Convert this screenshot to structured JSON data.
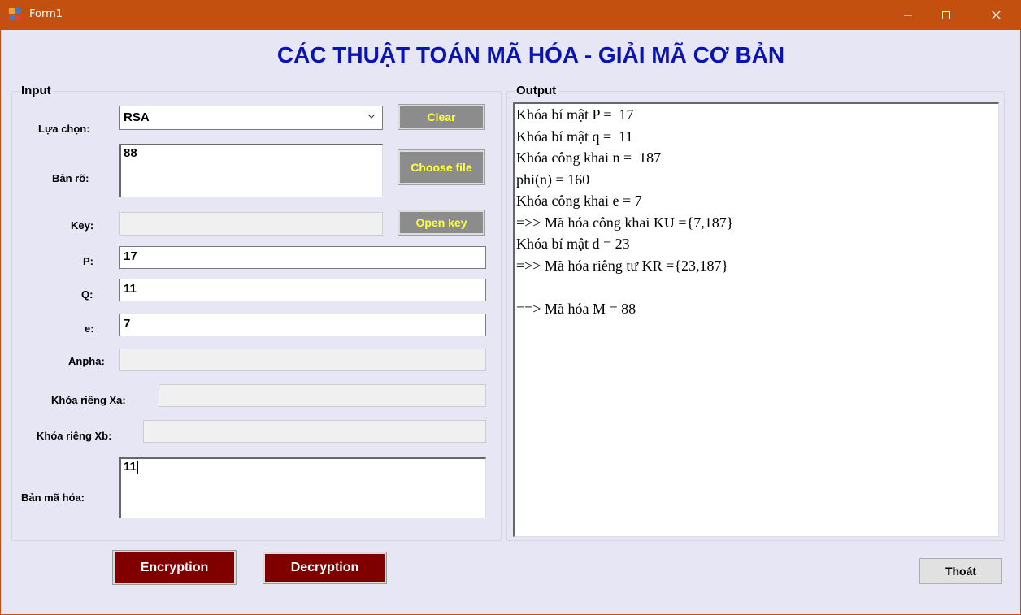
{
  "window": {
    "title": "Form1",
    "min_label": "—",
    "max_label": "☐",
    "close_label": "✕"
  },
  "main_title": "CÁC THUẬT TOÁN MÃ HÓA - GIẢI MÃ CƠ BẢN",
  "input": {
    "group_title": "Input",
    "choice_label": "Lựa chọn:",
    "choice_value": "RSA",
    "plaintext_label": "Bản rõ:",
    "plaintext_value": "88",
    "key_label": "Key:",
    "key_value": "",
    "p_label": "P:",
    "p_value": "17",
    "q_label": "Q:",
    "q_value": "11",
    "e_label": "e:",
    "e_value": "7",
    "alpha_label": "Anpha:",
    "alpha_value": "",
    "xa_label": "Khóa riêng Xa:",
    "xa_value": "",
    "xb_label": "Khóa riêng Xb:",
    "xb_value": "",
    "cipher_label": "Bản mã hóa:",
    "cipher_value": "11"
  },
  "buttons": {
    "clear": "Clear",
    "choose_file": "Choose file",
    "open_key": "Open key",
    "encrypt": "Encryption",
    "decrypt": "Decryption",
    "exit": "Thoát"
  },
  "output": {
    "group_title": "Output",
    "lines": [
      "Khóa bí mật P =  17",
      "Khóa bí mật q =  11",
      "Khóa công khai n =  187",
      "phi(n) = 160",
      "Khóa công khai e = 7",
      "=>> Mã hóa công khai KU ={7,187}",
      "Khóa bí mật d = 23",
      "=>> Mã hóa riêng tư KR ={23,187}",
      "",
      "==> Mã hóa M = 88"
    ]
  },
  "colors": {
    "titlebar": "#c4500f",
    "background": "#e6e6f5",
    "title_text": "#0a14b4",
    "gray_button": "#8c8c8c",
    "gray_button_text": "#ffff3c",
    "red_button": "#800000"
  }
}
